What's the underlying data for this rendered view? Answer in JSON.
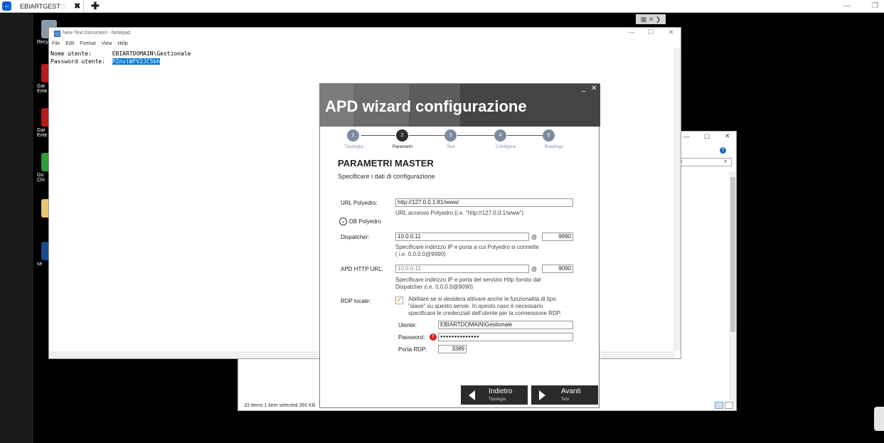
{
  "teamviewer": {
    "tab_label": "EBIARTGEST",
    "close_tab": "✖",
    "new_tab": "✚",
    "minimize": "—",
    "restore": "❐"
  },
  "remote_toggle": "▦ ✕ ❯",
  "desktop": {
    "icons": [
      {
        "label": "Recy",
        "color": "#8a9aa8"
      },
      {
        "label": "Gar\nEnte",
        "color": "#b51c1c"
      },
      {
        "label": "Gar\nEnte",
        "color": "#b51c1c"
      },
      {
        "label": "Go\nChr",
        "color": "#2c9e3a"
      },
      {
        "label": "",
        "color": "#e8c770"
      },
      {
        "label": "se",
        "color": "#1b4b8a"
      }
    ]
  },
  "notepad": {
    "title": "New Text Document - Notepad",
    "menu": [
      "File",
      "Edit",
      "Format",
      "View",
      "Help"
    ],
    "line1_label": "Nome utente:      ",
    "line1_value": "EBIARTDOMAIN\\Gestionale",
    "line2_label": "Password utente:  ",
    "line2_value": "P2nviWFV2JC5bh"
  },
  "explorer": {
    "search_placeholder": "ner",
    "status": "33 items    1 item selected  355 KB"
  },
  "wizard": {
    "title": "APD wizard configurazione",
    "minimize": "_",
    "close": "✕",
    "steps": [
      {
        "num": "1",
        "label": "Tipologia"
      },
      {
        "num": "2",
        "label": "Parametri"
      },
      {
        "num": "3",
        "label": "Test"
      },
      {
        "num": "4",
        "label": "Configura"
      },
      {
        "num": "5",
        "label": "Riepilogo"
      }
    ],
    "active_step": 2,
    "page_title": "PARAMETRI MASTER",
    "page_subtitle": "Specificare i dati di configurazione",
    "url_label": "URL Polyedro:",
    "url_value": "http://127.0.0.1:81/www/",
    "url_help": "URL accesso Polyedro (i.e. \"http://127.0.0.1/www\")",
    "db_toggle": "DB Polyedro",
    "dispatcher_label": "Dispatcher:",
    "dispatcher_ip": "10.0.0.11",
    "dispatcher_port": "9990",
    "dispatcher_help_1": "Specificare indirizzo IP e porta a cui Polyedro si connette",
    "dispatcher_help_2": "( i.e. 0.0.0.0@9990)",
    "apd_label": "APD HTTP URL:",
    "apd_ip": "10.0.0.11",
    "apd_port": "9090",
    "apd_help_1": "Specificare  indirizzo  IP  e  porta  del  servizio  Http  fornito  dal",
    "apd_help_2": "Dispatcher (i.e. 0.0.0.0@9090)",
    "at_sign": "@",
    "rdp_label": "RDP locale:",
    "rdp_checked": true,
    "rdp_help_1": "Abilitare se si desidera attivare anche le funzionalità di tipo",
    "rdp_help_2": "\"slave\"  su  questo  server.  In  questo  caso  è  necessario",
    "rdp_help_3": "specificare le credenziali dell'utente per la connessione RDP.",
    "utente_label": "Utente:",
    "utente_value": "EBIARTDOMAIN\\Gestionale",
    "password_label": "Password:",
    "password_value": "●●●●●●●●●●●●●●",
    "porta_label": "Porta RDP:",
    "porta_value": "3389",
    "back_main": "Indietro",
    "back_sub": "Tipologia",
    "next_main": "Avanti",
    "next_sub": "Test"
  },
  "colors": {
    "step_inactive": "#7d8ba1",
    "step_active": "#2d2d2d",
    "selection": "#0078d7",
    "warning": "#d01c1c",
    "checkbox": "#e08a00"
  }
}
